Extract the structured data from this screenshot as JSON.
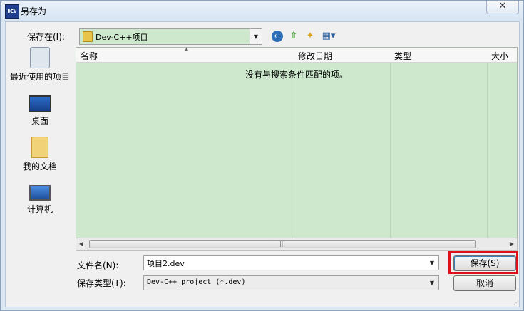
{
  "window": {
    "title": "另存为",
    "app_icon_text": "DEV",
    "close_glyph": "✕"
  },
  "toolbar": {
    "save_in_label": "保存在(I):",
    "location": "Dev-C++项目",
    "icons": [
      "back-icon",
      "up-folder-icon",
      "new-folder-icon",
      "view-menu-icon"
    ]
  },
  "places": [
    {
      "label": "最近使用的项目",
      "icon": "recent-items-icon"
    },
    {
      "label": "桌面",
      "icon": "desktop-icon"
    },
    {
      "label": "我的文档",
      "icon": "documents-icon"
    },
    {
      "label": "计算机",
      "icon": "computer-icon"
    }
  ],
  "filelist": {
    "columns": [
      "名称",
      "修改日期",
      "类型",
      "大小"
    ],
    "empty_message": "没有与搜索条件匹配的项。",
    "background": "#cde8cd"
  },
  "form": {
    "filename_label": "文件名(N):",
    "filename_value": "项目2.dev",
    "filetype_label": "保存类型(T):",
    "filetype_value": "Dev-C++ project (*.dev)"
  },
  "buttons": {
    "save": "保存(S)",
    "cancel": "取消"
  },
  "colors": {
    "highlight": "#e0101a",
    "accent": "#3c7fb1"
  }
}
